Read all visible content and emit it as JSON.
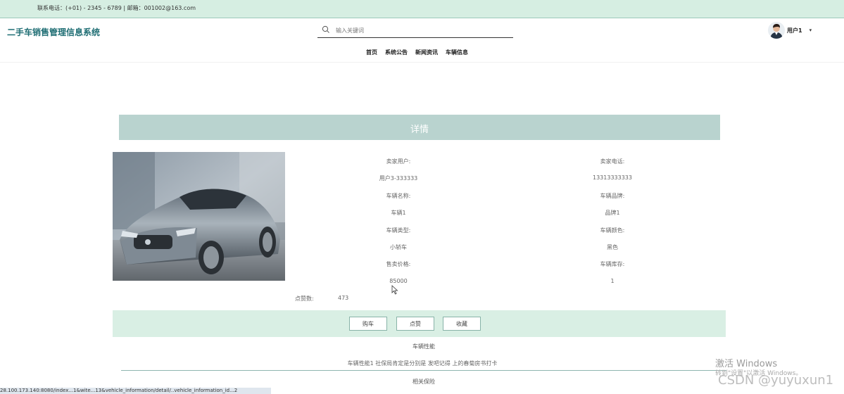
{
  "topbar": {
    "contact": "联系电话：(+01) - 2345 - 6789 | 邮箱：001002@163.com"
  },
  "header": {
    "site_title": "二手车销售管理信息系统",
    "search_placeholder": "输入关键词",
    "user_name": "用户1",
    "user_menu_chevron": "▾"
  },
  "nav": {
    "items": [
      {
        "label": "首页"
      },
      {
        "label": "系统公告"
      },
      {
        "label": "新闻资讯"
      },
      {
        "label": "车辆信息"
      }
    ]
  },
  "detail": {
    "banner_title": "详情",
    "fields": {
      "seller_user_label": "卖家用户:",
      "seller_user_value": "用户3-333333",
      "seller_phone_label": "卖家电话:",
      "seller_phone_value": "13313333333",
      "vehicle_name_label": "车辆名称:",
      "vehicle_name_value": "车辆1",
      "vehicle_brand_label": "车辆品牌:",
      "vehicle_brand_value": "品牌1",
      "vehicle_type_label": "车辆类型:",
      "vehicle_type_value": "小轿车",
      "vehicle_color_label": "车辆颜色:",
      "vehicle_color_value": "黑色",
      "price_label": "售卖价格:",
      "price_value": "85000",
      "stock_label": "车辆库存:",
      "stock_value": "1"
    },
    "likes_label": "点赞数:",
    "likes_value": "473"
  },
  "actions": {
    "buy_label": "购车",
    "like_label": "点赞",
    "favorite_label": "收藏"
  },
  "sections": {
    "performance_title": "车辆性能",
    "performance_text": "车辆性能1 社保局肯定是分别是 发吧记得 上的春菊房书打卡",
    "insurance_title": "相关保险"
  },
  "status_bar": {
    "url": "28.100.173.140:8080/index...1&wite...13&vehicle_information/detail/..vehicle_information_id...2"
  },
  "watermarks": {
    "activate_title": "激活 Windows",
    "activate_sub": "转到\"设置\"以激活 Windows。",
    "csdn": "CSDN @yuyuxun1"
  },
  "colors": {
    "topbar_bg": "#d6eee2",
    "title_color": "#1f6e74",
    "banner_bg": "#b9d3cf",
    "action_bar_bg": "#d9efe4"
  }
}
